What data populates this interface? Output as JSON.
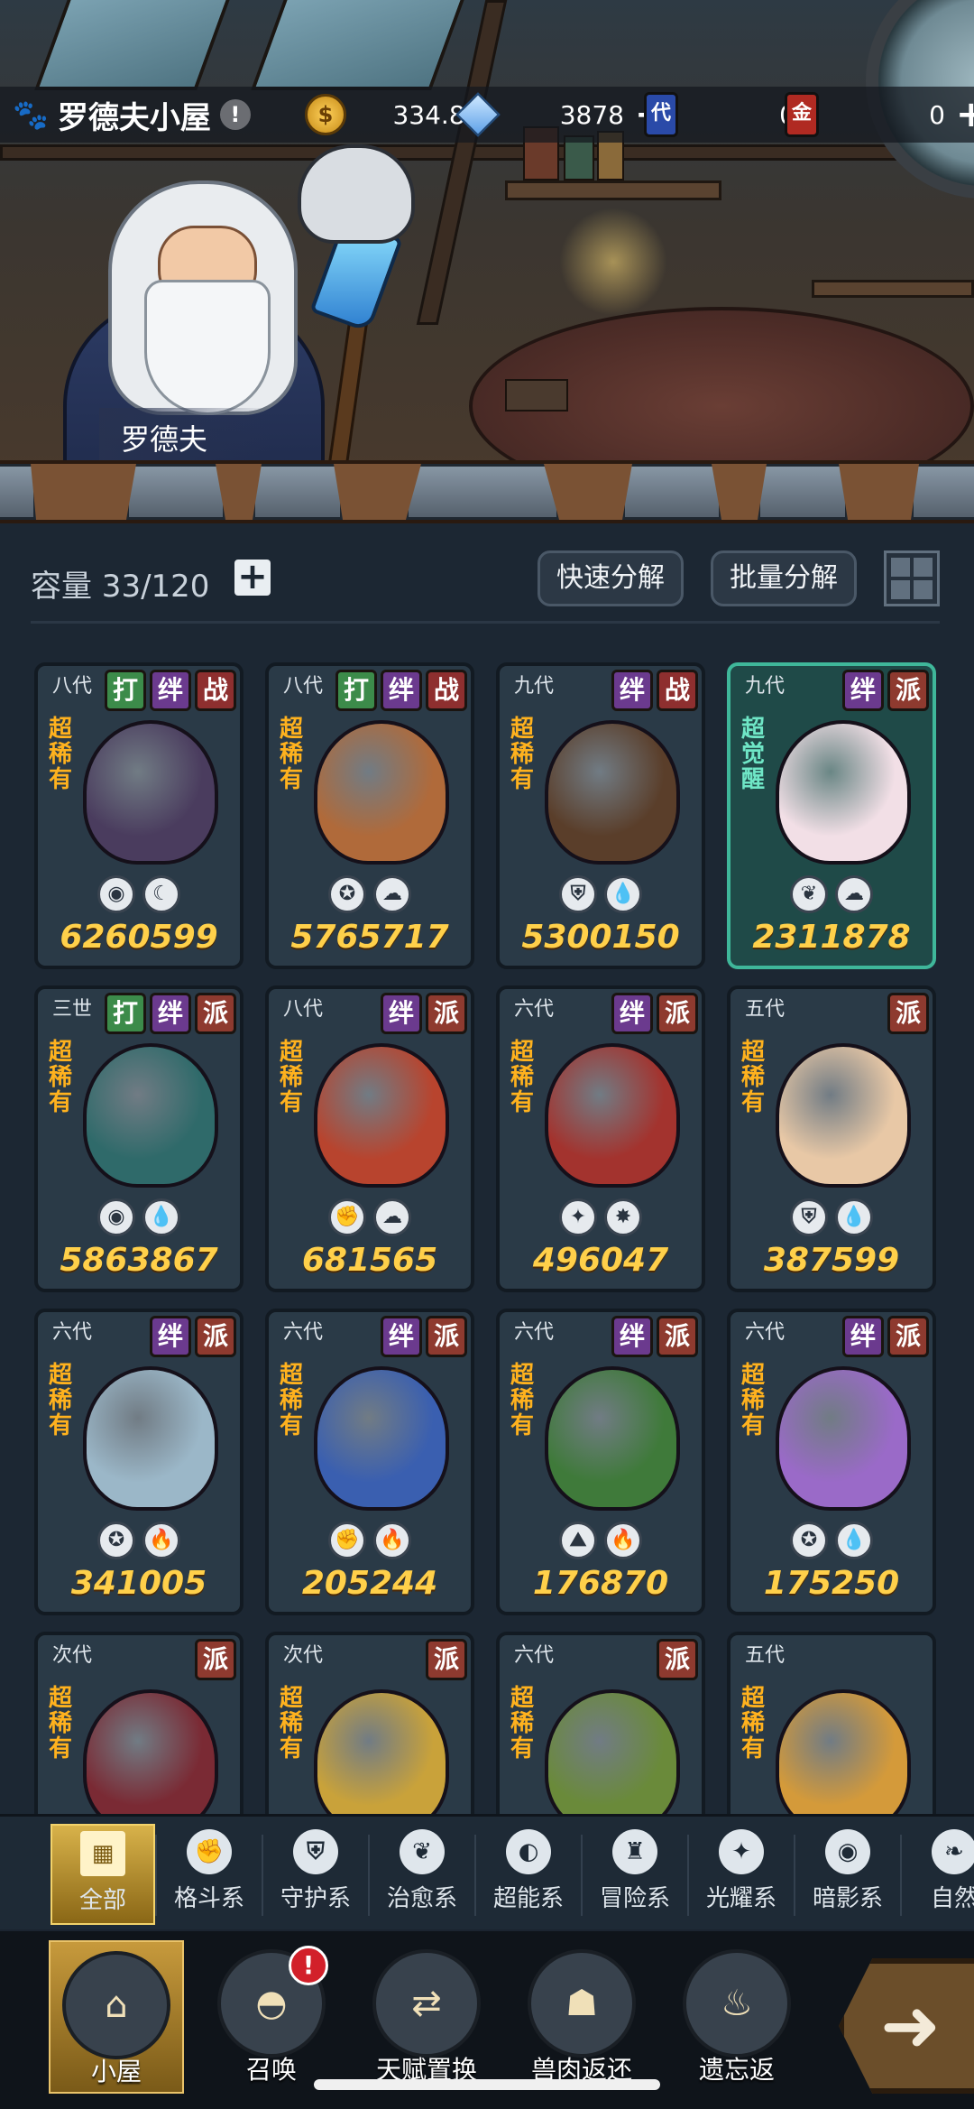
{
  "header": {
    "title": "罗德夫小屋",
    "info_symbol": "!",
    "npc_name": "罗德夫"
  },
  "resources": {
    "gold": "334.8K",
    "gold_icon": "coin-icon",
    "crystal": "3878",
    "crystal_icon": "crystal-icon",
    "ticket_blue_label": "代",
    "ticket_blue_value": "0",
    "ticket_red_label": "金",
    "ticket_red_value": "0",
    "plus": "+"
  },
  "inventory": {
    "capacity_label": "容量 33/120",
    "add_symbol": "+",
    "quick_decompose": "快速分解",
    "batch_decompose": "批量分解"
  },
  "cards": [
    {
      "gen": "八代",
      "tags": [
        "打",
        "绊",
        "战"
      ],
      "rarity": "超稀有",
      "elements": [
        "◉",
        "☾"
      ],
      "power": "6260599",
      "color": "#4a3c5e"
    },
    {
      "gen": "八代",
      "tags": [
        "打",
        "绊",
        "战"
      ],
      "rarity": "超稀有",
      "elements": [
        "✪",
        "☁"
      ],
      "power": "5765717",
      "color": "#b06a3a"
    },
    {
      "gen": "九代",
      "tags": [
        "绊",
        "战"
      ],
      "rarity": "超稀有",
      "elements": [
        "⛨",
        "💧"
      ],
      "power": "5300150",
      "color": "#5a3e2a"
    },
    {
      "gen": "九代",
      "tags": [
        "绊",
        "派"
      ],
      "rarity": "超觉醒",
      "elements": [
        "❦",
        "☁"
      ],
      "power": "2311878",
      "color": "#f2dfe6"
    },
    {
      "gen": "三世",
      "tags": [
        "打",
        "绊",
        "派"
      ],
      "rarity": "超稀有",
      "elements": [
        "◉",
        "💧"
      ],
      "power": "5863867",
      "color": "#2f6a6a"
    },
    {
      "gen": "八代",
      "tags": [
        "绊",
        "派"
      ],
      "rarity": "超稀有",
      "elements": [
        "✊",
        "☁"
      ],
      "power": "681565",
      "color": "#b8442e"
    },
    {
      "gen": "六代",
      "tags": [
        "绊",
        "派"
      ],
      "rarity": "超稀有",
      "elements": [
        "✦",
        "✸"
      ],
      "power": "496047",
      "color": "#a3332e"
    },
    {
      "gen": "五代",
      "tags": [
        "派"
      ],
      "rarity": "超稀有",
      "elements": [
        "⛨",
        "💧"
      ],
      "power": "387599",
      "color": "#e8c8a6"
    },
    {
      "gen": "六代",
      "tags": [
        "绊",
        "派"
      ],
      "rarity": "超稀有",
      "elements": [
        "✪",
        "🔥"
      ],
      "power": "341005",
      "color": "#9bb7c8"
    },
    {
      "gen": "六代",
      "tags": [
        "绊",
        "派"
      ],
      "rarity": "超稀有",
      "elements": [
        "✊",
        "🔥"
      ],
      "power": "205244",
      "color": "#3a5fb0"
    },
    {
      "gen": "六代",
      "tags": [
        "绊",
        "派"
      ],
      "rarity": "超稀有",
      "elements": [
        "⛰",
        "🔥"
      ],
      "power": "176870",
      "color": "#3f7a3a"
    },
    {
      "gen": "六代",
      "tags": [
        "绊",
        "派"
      ],
      "rarity": "超稀有",
      "elements": [
        "✪",
        "💧"
      ],
      "power": "175250",
      "color": "#9a6ac8"
    },
    {
      "gen": "次代",
      "tags": [
        "派"
      ],
      "rarity": "超稀有",
      "elements": [],
      "power": "",
      "color": "#7a2a34"
    },
    {
      "gen": "次代",
      "tags": [
        "派"
      ],
      "rarity": "超稀有",
      "elements": [],
      "power": "",
      "color": "#c9a23a"
    },
    {
      "gen": "六代",
      "tags": [
        "派"
      ],
      "rarity": "超稀有",
      "elements": [],
      "power": "",
      "color": "#6a8a3a"
    },
    {
      "gen": "五代",
      "tags": [],
      "rarity": "超稀有",
      "elements": [],
      "power": "",
      "color": "#d49a3a"
    }
  ],
  "categories": [
    {
      "label": "全部",
      "icon": "all-icon",
      "glyph": "▦"
    },
    {
      "label": "格斗系",
      "icon": "fist-icon",
      "glyph": "✊"
    },
    {
      "label": "守护系",
      "icon": "shield-icon",
      "glyph": "⛨"
    },
    {
      "label": "治愈系",
      "icon": "sprout-icon",
      "glyph": "❦"
    },
    {
      "label": "超能系",
      "icon": "alien-icon",
      "glyph": "◐"
    },
    {
      "label": "冒险系",
      "icon": "helmet-icon",
      "glyph": "♜"
    },
    {
      "label": "光耀系",
      "icon": "star-icon",
      "glyph": "✦"
    },
    {
      "label": "暗影系",
      "icon": "eye-icon",
      "glyph": "◉"
    },
    {
      "label": "自然",
      "icon": "leaf-icon",
      "glyph": "❧"
    }
  ],
  "nav": [
    {
      "label": "小屋",
      "icon": "house-icon",
      "glyph": "⌂"
    },
    {
      "label": "召唤",
      "icon": "egg-icon",
      "glyph": "◓"
    },
    {
      "label": "天赋置换",
      "icon": "swap-icon",
      "glyph": "⇄"
    },
    {
      "label": "兽肉返还",
      "icon": "meat-icon",
      "glyph": "☗"
    },
    {
      "label": "遗忘返",
      "icon": "flame-icon",
      "glyph": "♨"
    }
  ],
  "nav_badge": "!",
  "go_arrow": "➜"
}
